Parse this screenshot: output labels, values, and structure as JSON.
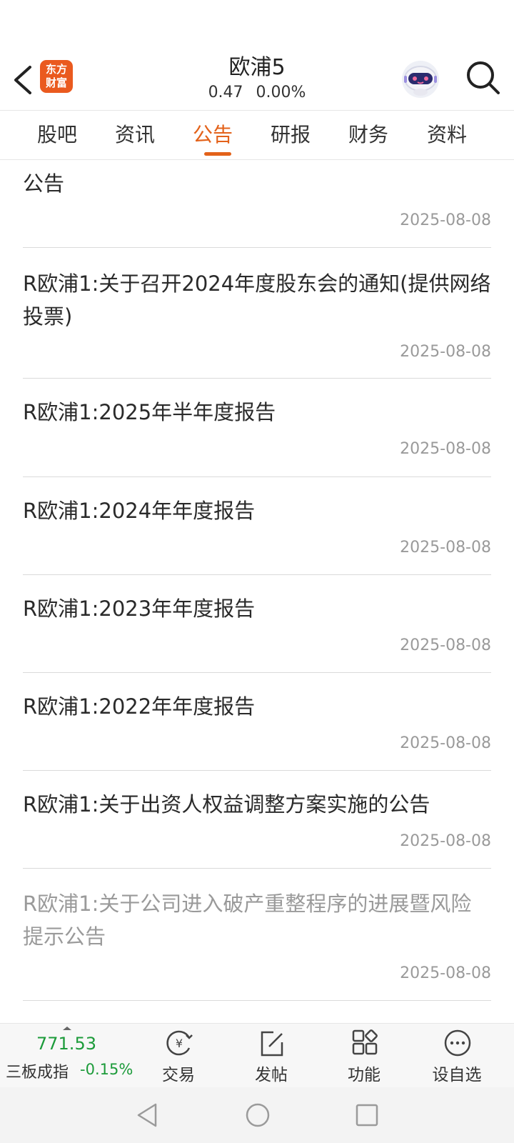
{
  "header": {
    "logo_line1": "东方",
    "logo_line2": "财富",
    "title": "欧浦5",
    "price": "0.47",
    "change_pct": "0.00%"
  },
  "tabs": [
    {
      "label": "股吧"
    },
    {
      "label": "资讯"
    },
    {
      "label": "公告"
    },
    {
      "label": "研报"
    },
    {
      "label": "财务"
    },
    {
      "label": "资料"
    }
  ],
  "active_tab": "公告",
  "announcements": [
    {
      "title": "公告",
      "date": "2025-08-08",
      "read": false
    },
    {
      "title": "R欧浦1:关于召开2024年度股东会的通知(提供网络投票)",
      "date": "2025-08-08",
      "read": false
    },
    {
      "title": "R欧浦1:2025年半年度报告",
      "date": "2025-08-08",
      "read": false
    },
    {
      "title": "R欧浦1:2024年年度报告",
      "date": "2025-08-08",
      "read": false
    },
    {
      "title": "R欧浦1:2023年年度报告",
      "date": "2025-08-08",
      "read": false
    },
    {
      "title": "R欧浦1:2022年年度报告",
      "date": "2025-08-08",
      "read": false
    },
    {
      "title": "R欧浦1:关于出资人权益调整方案实施的公告",
      "date": "2025-08-08",
      "read": false
    },
    {
      "title": "R欧浦1:关于公司进入破产重整程序的进展暨风险提示公告",
      "date": "2025-08-08",
      "read": true
    }
  ],
  "bottom_bar": {
    "index_value": "771.53",
    "index_name": "三板成指",
    "index_change": "-0.15%",
    "trade_label": "交易",
    "post_label": "发帖",
    "functions_label": "功能",
    "watchlist_label": "设自选"
  },
  "colors": {
    "accent": "#e3621a",
    "logo_bg": "#ea5a1f",
    "down_green": "#1c9b3a",
    "read_gray": "#9a9a9a"
  },
  "icons": [
    "back-arrow-icon",
    "robot-assistant-icon",
    "search-icon",
    "trade-yen-icon",
    "edit-post-icon",
    "function-grid-icon",
    "more-dots-icon",
    "nav-back-icon",
    "nav-home-icon",
    "nav-recents-icon"
  ]
}
